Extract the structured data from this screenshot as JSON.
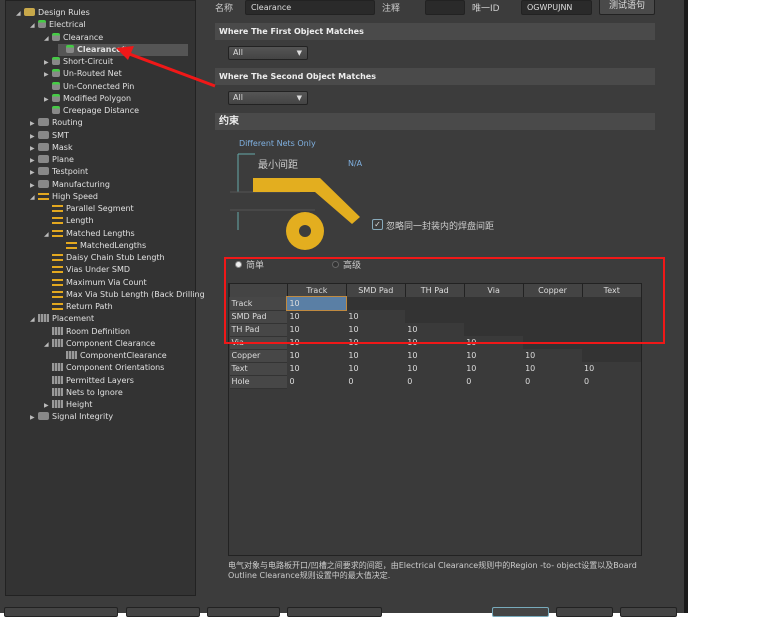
{
  "tree": [
    {
      "label": "Design Rules",
      "level": 0,
      "expander": "open",
      "icon": "folder-icon"
    },
    {
      "label": "Electrical",
      "level": 1,
      "expander": "open",
      "icon": "rule-icon"
    },
    {
      "label": "Clearance",
      "level": 2,
      "expander": "open",
      "icon": "rule-icon"
    },
    {
      "label": "Clearance*",
      "level": 3,
      "expander": "",
      "icon": "rule-icon",
      "selected": true
    },
    {
      "label": "Short-Circuit",
      "level": 2,
      "expander": "closed",
      "icon": "rule-icon"
    },
    {
      "label": "Un-Routed Net",
      "level": 2,
      "expander": "closed",
      "icon": "rule-icon"
    },
    {
      "label": "Un-Connected Pin",
      "level": 2,
      "expander": "",
      "icon": "rule-icon"
    },
    {
      "label": "Modified Polygon",
      "level": 2,
      "expander": "closed",
      "icon": "rule-icon"
    },
    {
      "label": "Creepage Distance",
      "level": 2,
      "expander": "",
      "icon": "rule-icon"
    },
    {
      "label": "Routing",
      "level": 1,
      "expander": "closed",
      "icon": "routing-icon"
    },
    {
      "label": "SMT",
      "level": 1,
      "expander": "closed",
      "icon": "smt-icon"
    },
    {
      "label": "Mask",
      "level": 1,
      "expander": "closed",
      "icon": "mask-icon"
    },
    {
      "label": "Plane",
      "level": 1,
      "expander": "closed",
      "icon": "plane-icon"
    },
    {
      "label": "Testpoint",
      "level": 1,
      "expander": "closed",
      "icon": "testpoint-icon"
    },
    {
      "label": "Manufacturing",
      "level": 1,
      "expander": "closed",
      "icon": "manufacturing-icon"
    },
    {
      "label": "High Speed",
      "level": 1,
      "expander": "open",
      "icon": "high-speed-icon"
    },
    {
      "label": "Parallel Segment",
      "level": 2,
      "expander": "",
      "icon": "high-speed-icon"
    },
    {
      "label": "Length",
      "level": 2,
      "expander": "",
      "icon": "high-speed-icon"
    },
    {
      "label": "Matched Lengths",
      "level": 2,
      "expander": "open",
      "icon": "high-speed-icon"
    },
    {
      "label": "MatchedLengths",
      "level": 3,
      "expander": "",
      "icon": "high-speed-icon"
    },
    {
      "label": "Daisy Chain Stub Length",
      "level": 2,
      "expander": "",
      "icon": "high-speed-icon"
    },
    {
      "label": "Vias Under SMD",
      "level": 2,
      "expander": "",
      "icon": "high-speed-icon"
    },
    {
      "label": "Maximum Via Count",
      "level": 2,
      "expander": "",
      "icon": "high-speed-icon"
    },
    {
      "label": "Max Via Stub Length (Back Drilling",
      "level": 2,
      "expander": "",
      "icon": "high-speed-icon"
    },
    {
      "label": "Return Path",
      "level": 2,
      "expander": "",
      "icon": "high-speed-icon"
    },
    {
      "label": "Placement",
      "level": 1,
      "expander": "open",
      "icon": "placement-icon"
    },
    {
      "label": "Room Definition",
      "level": 2,
      "expander": "",
      "icon": "placement-icon"
    },
    {
      "label": "Component Clearance",
      "level": 2,
      "expander": "open",
      "icon": "placement-icon"
    },
    {
      "label": "ComponentClearance",
      "level": 3,
      "expander": "",
      "icon": "placement-icon"
    },
    {
      "label": "Component Orientations",
      "level": 2,
      "expander": "",
      "icon": "placement-icon"
    },
    {
      "label": "Permitted Layers",
      "level": 2,
      "expander": "",
      "icon": "placement-icon"
    },
    {
      "label": "Nets to Ignore",
      "level": 2,
      "expander": "",
      "icon": "placement-icon"
    },
    {
      "label": "Height",
      "level": 2,
      "expander": "closed",
      "icon": "placement-icon"
    },
    {
      "label": "Signal Integrity",
      "level": 1,
      "expander": "closed",
      "icon": "signal-integrity-icon"
    }
  ],
  "form": {
    "name_label": "名称",
    "name_value": "Clearance",
    "comment_label": "注释",
    "comment_value": "",
    "id_label": "唯一ID",
    "id_value": "OGWPUJNN",
    "test_button": "测试语句",
    "first_header": "Where The First Object Matches",
    "first_value": "All",
    "second_header": "Where The Second Object Matches",
    "second_value": "All",
    "constraints_header": "约束",
    "different_nets": "Different Nets Only",
    "min_clearance_label": "最小间距",
    "min_clearance_value": "N/A",
    "ignore_pads_label": "忽略同一封装内的焊盘间距",
    "ignore_pads_checked": true,
    "mode_simple": "简单",
    "mode_advanced": "高级",
    "mode_selected": "simple"
  },
  "grid": {
    "columns": [
      "Track",
      "SMD Pad",
      "TH Pad",
      "Via",
      "Copper",
      "Text"
    ],
    "rows": [
      {
        "label": "Track",
        "values": [
          "10"
        ]
      },
      {
        "label": "SMD Pad",
        "values": [
          "10",
          "10"
        ]
      },
      {
        "label": "TH Pad",
        "values": [
          "10",
          "10",
          "10"
        ]
      },
      {
        "label": "Via",
        "values": [
          "10",
          "10",
          "10",
          "10"
        ]
      },
      {
        "label": "Copper",
        "values": [
          "10",
          "10",
          "10",
          "10",
          "10"
        ]
      },
      {
        "label": "Text",
        "values": [
          "10",
          "10",
          "10",
          "10",
          "10",
          "10"
        ]
      },
      {
        "label": "Hole",
        "values": [
          "0",
          "0",
          "0",
          "0",
          "0",
          "0"
        ]
      }
    ]
  },
  "note": "电气对象与电路板开口/凹槽之间要求的间距，由Electrical Clearance规则中的Region -to- object设置以及Board Outline Clearance规则设置中的最大值决定.",
  "colors": {
    "annotation": "#f01818",
    "pad": "#e3ae1f",
    "accent_text": "#7fb0e0"
  }
}
